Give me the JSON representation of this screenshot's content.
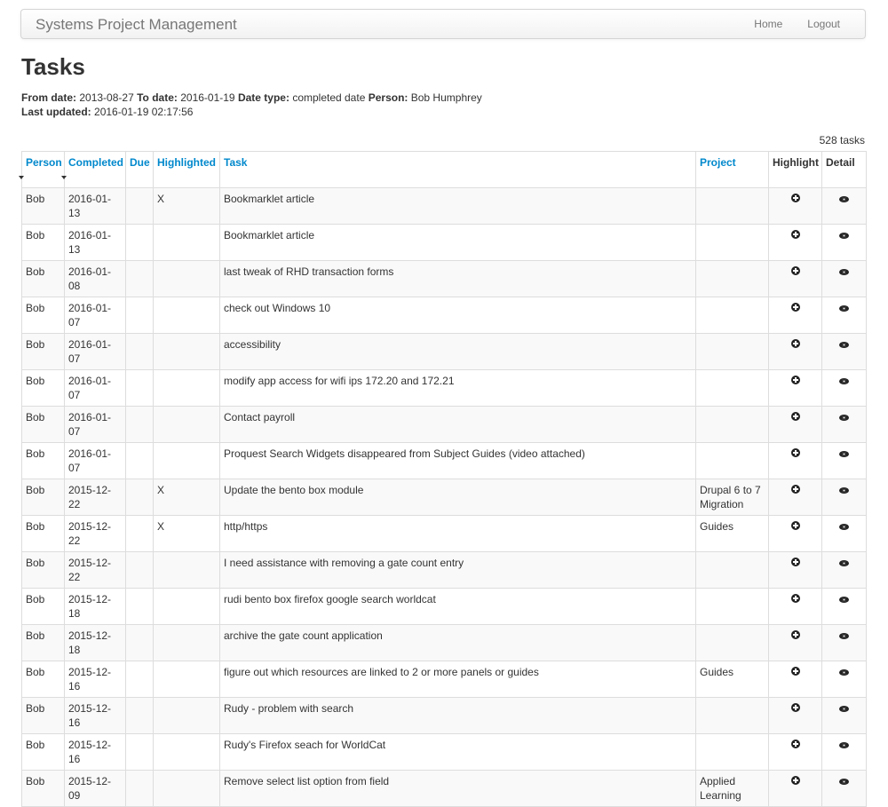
{
  "navbar": {
    "brand": "Systems Project Management",
    "home": "Home",
    "logout": "Logout"
  },
  "page": {
    "title": "Tasks",
    "filters": {
      "from_label": "From date:",
      "from_value": "2013-08-27",
      "to_label": "To date:",
      "to_value": "2016-01-19",
      "type_label": "Date type:",
      "type_value": "completed date",
      "person_label": "Person:",
      "person_value": "Bob Humphrey",
      "updated_label": "Last updated:",
      "updated_value": "2016-01-19 02:17:56"
    },
    "task_count": "528 tasks"
  },
  "table": {
    "headers": [
      "Person",
      "Completed",
      "Due",
      "Highlighted",
      "Task",
      "Project",
      "Highlight",
      "Detail"
    ],
    "rows": [
      {
        "person": "Bob",
        "completed": "2016-01-13",
        "due": "",
        "highlighted": "X",
        "task": "Bookmarklet article",
        "project": ""
      },
      {
        "person": "Bob",
        "completed": "2016-01-13",
        "due": "",
        "highlighted": "",
        "task": "Bookmarklet article",
        "project": ""
      },
      {
        "person": "Bob",
        "completed": "2016-01-08",
        "due": "",
        "highlighted": "",
        "task": "last tweak of RHD transaction forms",
        "project": ""
      },
      {
        "person": "Bob",
        "completed": "2016-01-07",
        "due": "",
        "highlighted": "",
        "task": "check out Windows 10",
        "project": ""
      },
      {
        "person": "Bob",
        "completed": "2016-01-07",
        "due": "",
        "highlighted": "",
        "task": "accessibility",
        "project": ""
      },
      {
        "person": "Bob",
        "completed": "2016-01-07",
        "due": "",
        "highlighted": "",
        "task": "modify app access for wifi ips 172.20 and 172.21",
        "project": ""
      },
      {
        "person": "Bob",
        "completed": "2016-01-07",
        "due": "",
        "highlighted": "",
        "task": "Contact payroll",
        "project": ""
      },
      {
        "person": "Bob",
        "completed": "2016-01-07",
        "due": "",
        "highlighted": "",
        "task": "Proquest Search Widgets disappeared from Subject Guides (video attached)",
        "project": ""
      },
      {
        "person": "Bob",
        "completed": "2015-12-22",
        "due": "",
        "highlighted": "X",
        "task": "Update the bento box module",
        "project": "Drupal 6 to 7 Migration"
      },
      {
        "person": "Bob",
        "completed": "2015-12-22",
        "due": "",
        "highlighted": "X",
        "task": "http/https",
        "project": "Guides"
      },
      {
        "person": "Bob",
        "completed": "2015-12-22",
        "due": "",
        "highlighted": "",
        "task": "I need assistance with removing a gate count entry",
        "project": ""
      },
      {
        "person": "Bob",
        "completed": "2015-12-18",
        "due": "",
        "highlighted": "",
        "task": "rudi bento box firefox google search worldcat",
        "project": ""
      },
      {
        "person": "Bob",
        "completed": "2015-12-18",
        "due": "",
        "highlighted": "",
        "task": "archive the gate count application",
        "project": ""
      },
      {
        "person": "Bob",
        "completed": "2015-12-16",
        "due": "",
        "highlighted": "",
        "task": "figure out which resources are linked to 2 or more panels or guides",
        "project": "Guides"
      },
      {
        "person": "Bob",
        "completed": "2015-12-16",
        "due": "",
        "highlighted": "",
        "task": "Rudy - problem with search",
        "project": ""
      },
      {
        "person": "Bob",
        "completed": "2015-12-16",
        "due": "",
        "highlighted": "",
        "task": "Rudy's Firefox seach for WorldCat",
        "project": ""
      },
      {
        "person": "Bob",
        "completed": "2015-12-09",
        "due": "",
        "highlighted": "",
        "task": "Remove select list option from field",
        "project": "Applied Learning"
      }
    ],
    "icons": {
      "highlight": "plus-sign-icon",
      "detail": "eye-icon"
    },
    "link_color": "#0088cc"
  }
}
